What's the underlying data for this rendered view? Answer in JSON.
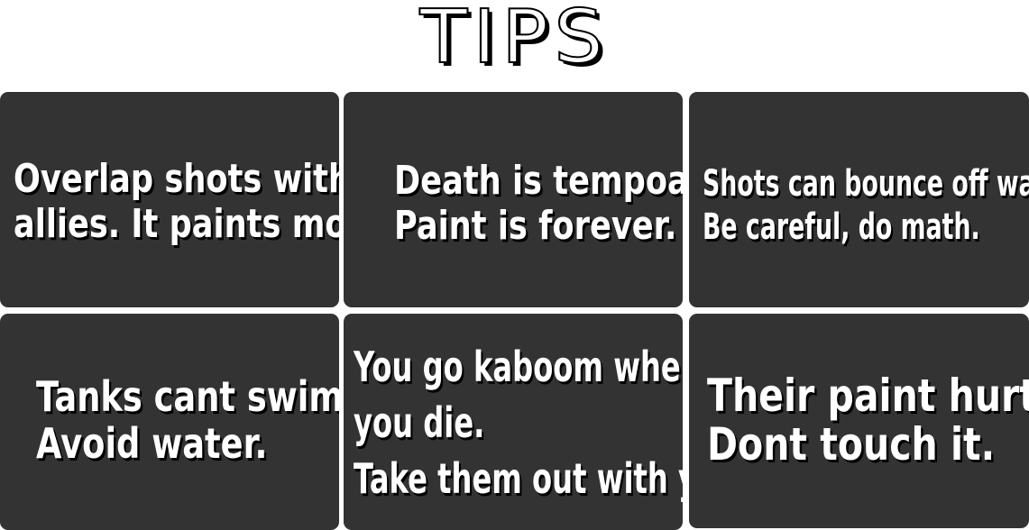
{
  "title": "TIPS",
  "colors": {
    "background": "#ffffff",
    "card": "#333333",
    "text": "#ffffff",
    "shadow": "#000000"
  },
  "tips": [
    {
      "lines": [
        "Overlap shots with",
        "allies. It paints more."
      ]
    },
    {
      "lines": [
        "Death is tempoary.",
        "Paint is forever."
      ]
    },
    {
      "lines": [
        "Shots can bounce off walls.",
        "Be careful, do math."
      ]
    },
    {
      "lines": [
        "Tanks cant swim.",
        "Avoid water."
      ]
    },
    {
      "lines": [
        "You go kaboom when",
        "you die.",
        "Take them out with you."
      ]
    },
    {
      "lines": [
        "Their paint hurts.",
        "Dont touch it."
      ]
    }
  ]
}
